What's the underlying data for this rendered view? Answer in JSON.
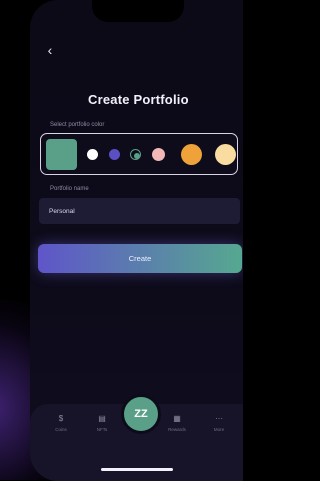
{
  "header": {
    "back_icon": "chevron-left-icon",
    "back_glyph": "‹",
    "title": "Create Portfolio"
  },
  "color_picker": {
    "label": "Select portfolio color",
    "selected_color": "#5aa088",
    "options": [
      {
        "name": "white",
        "color": "#ffffff"
      },
      {
        "name": "indigo",
        "color": "#5b4fc4"
      },
      {
        "name": "green",
        "color": "#5aa088"
      },
      {
        "name": "pink",
        "color": "#f2b7b7"
      },
      {
        "name": "orange",
        "color": "#f0a23a"
      },
      {
        "name": "cream",
        "color": "#f8dca0"
      }
    ]
  },
  "portfolio_name": {
    "label": "Portfolio name",
    "value": "Personal",
    "placeholder": ""
  },
  "create_button": {
    "label": "Create"
  },
  "bottom_nav": {
    "items": [
      {
        "name": "coins",
        "label": "Coins",
        "icon": "dollar-coin-icon",
        "glyph": "$"
      },
      {
        "name": "nfts",
        "label": "NFTs",
        "icon": "nft-stack-icon",
        "glyph": "▤"
      },
      {
        "name": "center",
        "label": "",
        "icon": "zz-logo-icon",
        "glyph": "ZZ"
      },
      {
        "name": "rewards",
        "label": "Rewards",
        "icon": "gift-icon",
        "glyph": "▦"
      },
      {
        "name": "more",
        "label": "More",
        "icon": "more-dots-icon",
        "glyph": "···"
      }
    ]
  },
  "colors": {
    "accent": "#5aa088",
    "primary": "#5f55c9",
    "background": "#0d0b1a"
  }
}
